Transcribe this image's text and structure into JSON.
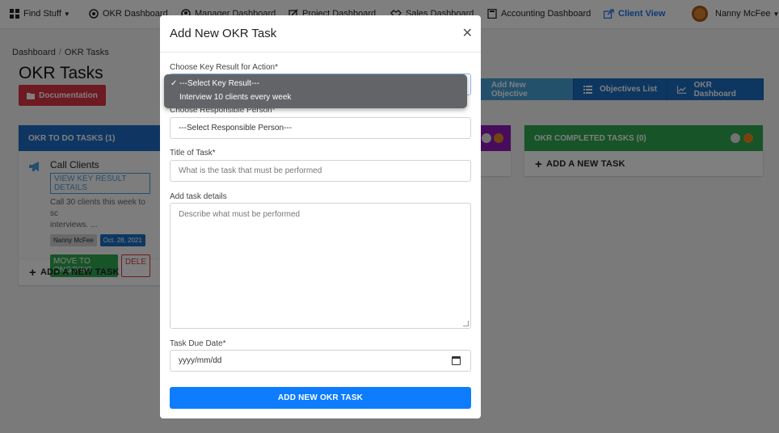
{
  "nav": {
    "items": [
      {
        "label": "Find Stuff",
        "icon": "grid-icon"
      },
      {
        "label": "OKR Dashboard",
        "icon": "target-icon"
      },
      {
        "label": "Manager Dashboard",
        "icon": "person-icon"
      },
      {
        "label": "Project Dashboard",
        "icon": "pencil-icon"
      },
      {
        "label": "Sales Dashboard",
        "icon": "handshake-icon"
      },
      {
        "label": "Accounting Dashboard",
        "icon": "calculator-icon"
      },
      {
        "label": "Client View",
        "icon": "share-icon"
      }
    ],
    "user": "Nanny McFee"
  },
  "breadcrumb": {
    "home": "Dashboard",
    "separator": "/",
    "current": "OKR Tasks"
  },
  "page_title": "OKR Tasks",
  "documentation_label": "Documentation",
  "toolbar": {
    "add_objective": "Add New Objective",
    "objectives_list": "Objectives List",
    "okr_dashboard": "OKR Dashboard"
  },
  "columns": {
    "todo": {
      "title": "OKR TO DO TASKS (1)",
      "color": "#1f6cc4",
      "task": {
        "title": "Call Clients",
        "kr_link": "VIEW KEY RESULT DETAILS",
        "desc_line1": "Call 30 clients this week to sc",
        "desc_line2": "interviews. ...",
        "assignee": "Nanny McFee",
        "date": "Oct. 28, 2021",
        "move_label": "MOVE TO ONGOING",
        "delete_label": "DELE"
      },
      "add_label": "ADD A NEW TASK"
    },
    "ongoing": {
      "color": "#8e1bb8"
    },
    "completed": {
      "title": "OKR COMPLETED TASKS (0)",
      "color": "#2fa84f",
      "add_label": "ADD A NEW TASK"
    }
  },
  "modal": {
    "title": "Add New OKR Task",
    "key_result_label": "Choose Key Result for Action*",
    "key_result_options": [
      "---Select Key Result---",
      "Interview 10 clients every week"
    ],
    "person_label": "Choose Responsible Person*",
    "person_value": "---Select Responsible Person---",
    "task_title_label": "Title of Task*",
    "task_title_placeholder": "What is the task that must be performed",
    "details_label": "Add task details",
    "details_placeholder": "Describe what must be performed",
    "due_label": "Task Due Date*",
    "due_placeholder": "yyyy/mm/dd",
    "submit_label": "ADD NEW OKR TASK"
  }
}
